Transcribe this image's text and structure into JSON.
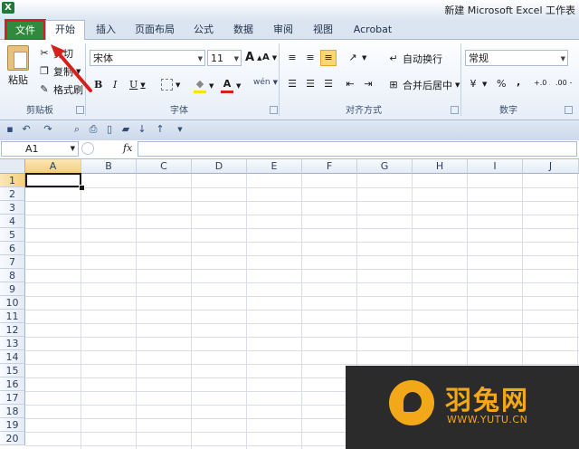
{
  "title": {
    "app_icon": "X",
    "text": "新建 Microsoft Excel 工作表"
  },
  "tabs": [
    {
      "id": "file",
      "label": "文件"
    },
    {
      "id": "home",
      "label": "开始"
    },
    {
      "id": "insert",
      "label": "插入"
    },
    {
      "id": "layout",
      "label": "页面布局"
    },
    {
      "id": "formulas",
      "label": "公式"
    },
    {
      "id": "data",
      "label": "数据"
    },
    {
      "id": "review",
      "label": "审阅"
    },
    {
      "id": "view",
      "label": "视图"
    },
    {
      "id": "acrobat",
      "label": "Acrobat"
    }
  ],
  "clipboard": {
    "paste": "粘贴",
    "cut": "剪切",
    "copy": "复制",
    "format_painter": "格式刷",
    "group_label": "剪贴板"
  },
  "font": {
    "name": "宋体",
    "size": "11",
    "grow": "A",
    "shrink": "A",
    "bold": "B",
    "italic": "I",
    "underline": "U",
    "group_label": "字体",
    "fill_glyph": "◆",
    "font_color_glyph": "A",
    "phonetic": "wén"
  },
  "alignment": {
    "wrap": "自动换行",
    "merge": "合并后居中",
    "group_label": "对齐方式"
  },
  "number": {
    "format": "常规",
    "percent": "%",
    "comma": ",",
    "inc_dec": "+.0 .00",
    "dec_dec": ".00 +.0",
    "group_label": "数字"
  },
  "formula_bar": {
    "name_box": "A1",
    "fx": "fx",
    "value": ""
  },
  "sheet": {
    "columns": [
      "A",
      "B",
      "C",
      "D",
      "E",
      "F",
      "G",
      "H",
      "I",
      "J"
    ],
    "rows": [
      "1",
      "2",
      "3",
      "4",
      "5",
      "6",
      "7",
      "8",
      "9",
      "10",
      "11",
      "12",
      "13",
      "14",
      "15",
      "16",
      "17",
      "18",
      "19",
      "20"
    ],
    "active_cell": "A1"
  },
  "watermark": {
    "name": "羽兔网",
    "url": "WWW.YUTU.CN"
  },
  "colors": {
    "file_tab": "#2f8a3d",
    "highlight_box": "#d8201a",
    "arrow": "#d8201a",
    "watermark_accent": "#f3a81a"
  }
}
